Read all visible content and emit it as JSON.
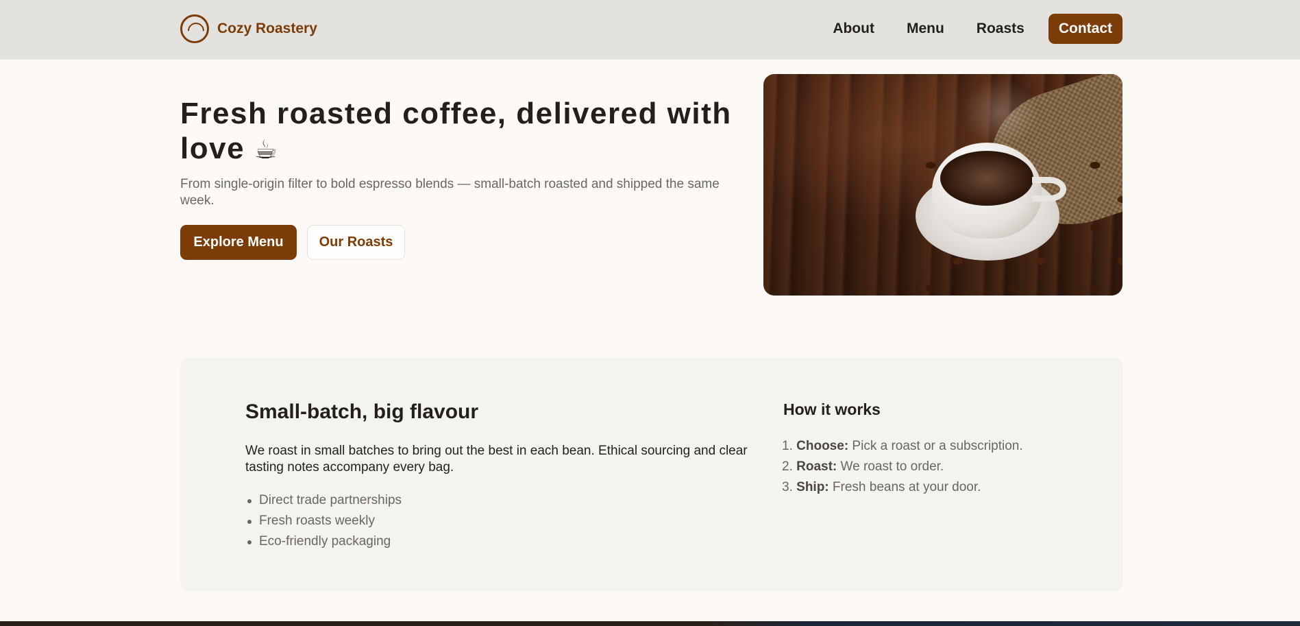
{
  "header": {
    "brand_name": "Cozy Roastery",
    "nav": {
      "about": "About",
      "menu": "Menu",
      "roasts": "Roasts",
      "contact": "Contact"
    }
  },
  "hero": {
    "title": "Fresh roasted coffee, delivered with love",
    "title_emoji": "☕",
    "subtitle": "From single-origin filter to bold espresso blends — small-batch roasted and shipped the same week.",
    "primary_button": "Explore Menu",
    "secondary_button": "Our Roasts",
    "image_icon": "coffee-cup-photo"
  },
  "features": {
    "title": "Small-batch, big flavour",
    "text": "We roast in small batches to bring out the best in each bean. Ethical sourcing and clear tasting notes accompany every bag.",
    "bullets": [
      "Direct trade partnerships",
      "Fresh roasts weekly",
      "Eco-friendly packaging"
    ]
  },
  "how_it_works": {
    "title": "How it works",
    "steps": [
      {
        "num": "1.",
        "term": "Choose:",
        "desc": "Pick a roast or a subscription."
      },
      {
        "num": "2.",
        "term": "Roast:",
        "desc": "We roast to order."
      },
      {
        "num": "3.",
        "term": "Ship:",
        "desc": "Fresh beans at your door."
      }
    ]
  },
  "colors": {
    "accent": "#7c3c07",
    "header_bg": "#e3e2df",
    "page_bg": "#fdf9f6",
    "card_bg": "#f5f3ef"
  }
}
